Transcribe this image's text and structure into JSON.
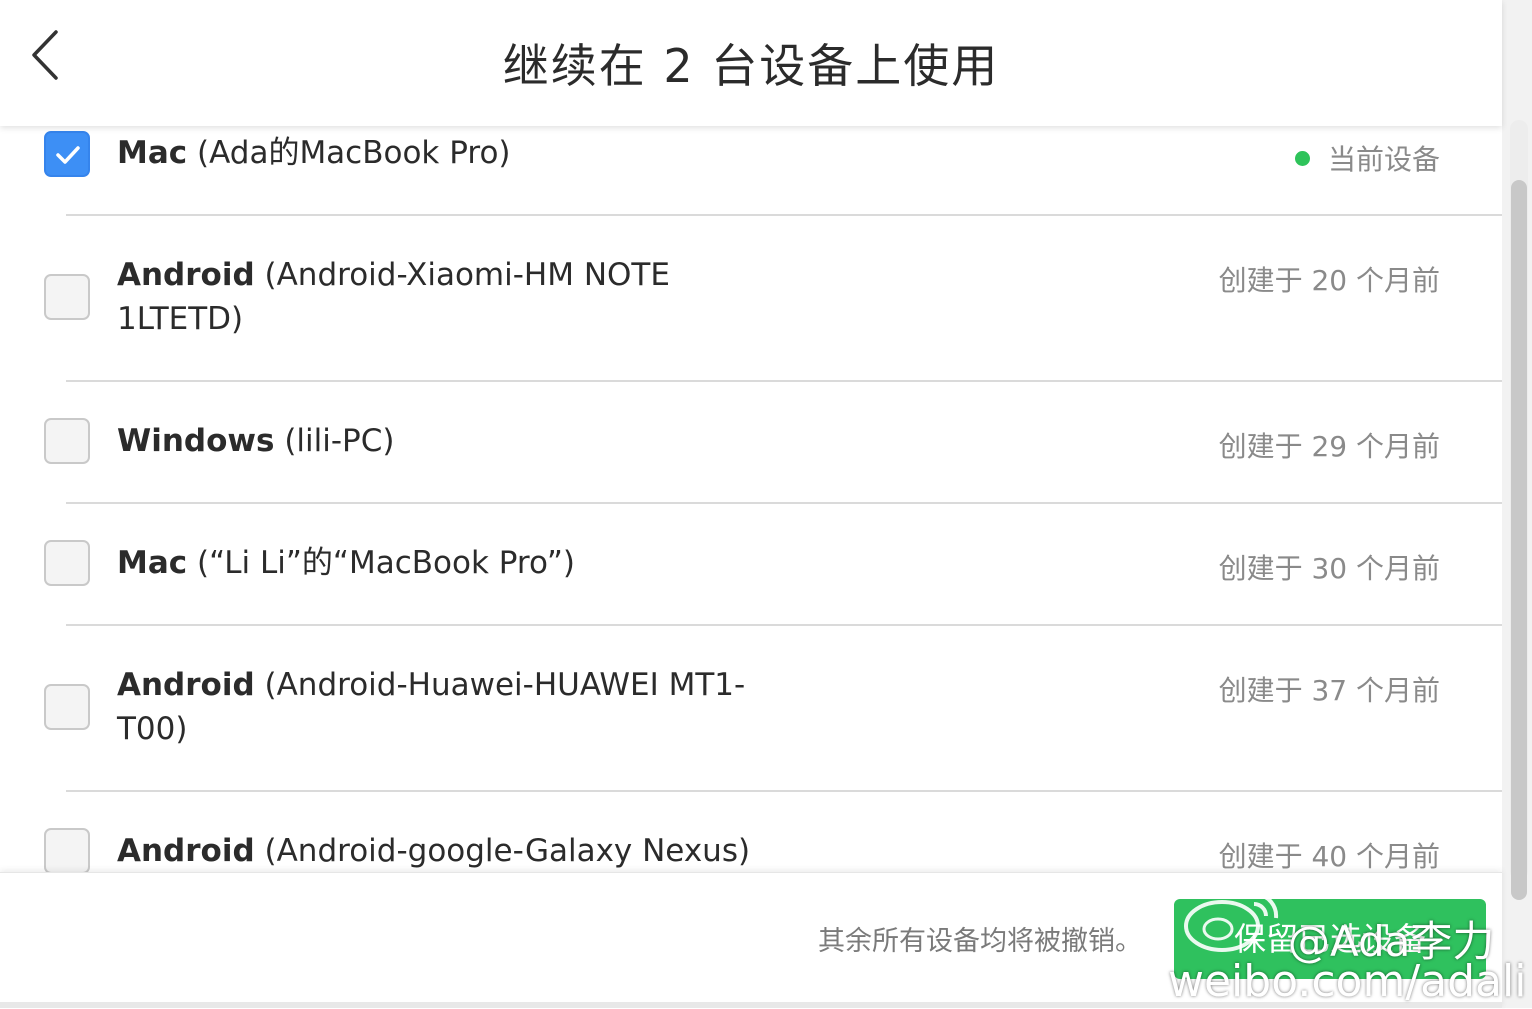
{
  "header": {
    "title": "继续在 2 台设备上使用"
  },
  "devices": [
    {
      "type": "Mac",
      "name": " (Ada的MacBook Pro)",
      "line2": "",
      "status": "当前设备",
      "checked": true,
      "current": true
    },
    {
      "type": "Android",
      "name": " (Android-Xiaomi-HM NOTE",
      "line2": "1LTETD)",
      "status": "创建于 20 个月前",
      "checked": false
    },
    {
      "type": "Windows",
      "name": " (lili-PC)",
      "line2": "",
      "status": "创建于 29 个月前",
      "checked": false
    },
    {
      "type": "Mac",
      "name": " (“Li Li”的“MacBook Pro”)",
      "line2": "",
      "status": "创建于 30 个月前",
      "checked": false
    },
    {
      "type": "Android",
      "name": " (Android-Huawei-HUAWEI MT1-",
      "line2": "T00)",
      "status": "创建于 37 个月前",
      "checked": false
    },
    {
      "type": "Android",
      "name": " (Android-google-Galaxy Nexus)",
      "line2": "",
      "status": "创建于 40 个月前",
      "checked": false
    }
  ],
  "footer": {
    "note": "其余所有设备均将被撤销。",
    "keep_button": "保留已选设备"
  },
  "watermark": {
    "handle": "@Ada李力",
    "url": "weibo.com/adali"
  },
  "colors": {
    "accent_blue": "#3d8ff5",
    "current_green": "#2ec35a",
    "button_green": "#2fc15e"
  },
  "icons": {
    "back": "chevron-left-icon",
    "check": "checkmark-icon",
    "status": "status-dot-icon",
    "weibo": "weibo-logo-icon"
  }
}
